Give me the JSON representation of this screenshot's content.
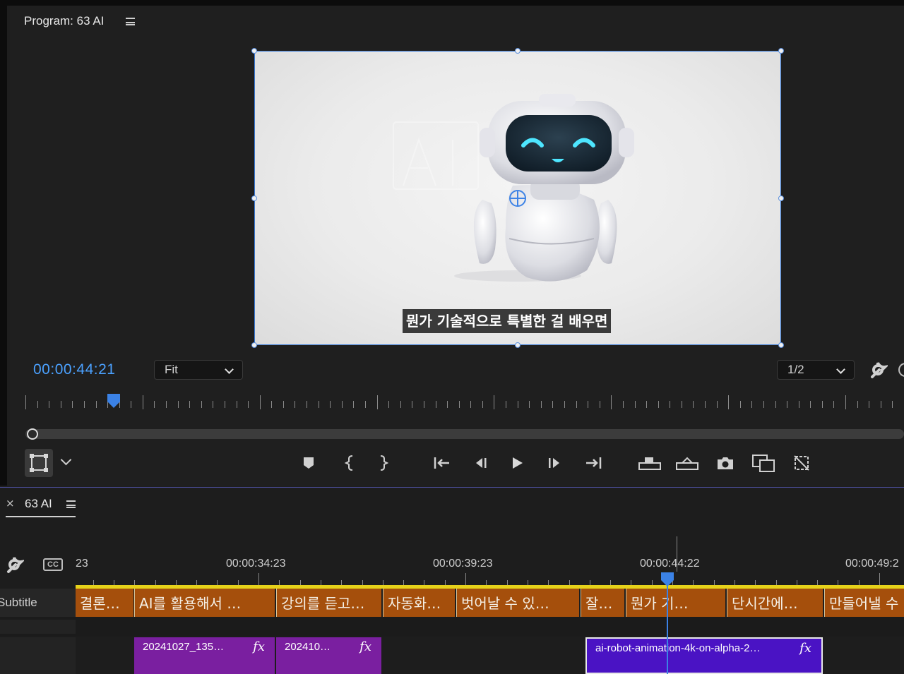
{
  "program_monitor": {
    "title": "Program: 63 AI",
    "subtitle_overlay": "뭔가 기술적으로 특별한 걸 배우면",
    "timecode": "00:00:44:21",
    "zoom_select": "Fit",
    "resolution_select": "1/2"
  },
  "timeline": {
    "tab_close": "×",
    "tab_label": "63 AI",
    "ruler_labels": [
      "23",
      "00:00:34:23",
      "00:00:39:23",
      "00:00:44:22",
      "00:00:49:2"
    ],
    "subtitle_track_label": "Subtitle",
    "subtitle_clips": [
      "결론…",
      "AI를 활용해서 …",
      "강의를 듣고…",
      "자동화…",
      "벗어날 수 있…",
      "잘…",
      "뭔가 기…",
      "단시간에…",
      "만들어낼 수"
    ],
    "video_clips": [
      {
        "label": "20241027_135…",
        "fx": "fx"
      },
      {
        "label": "202410…",
        "fx": "fx"
      },
      {
        "label": "ai-robot-animation-4k-on-alpha-2…",
        "fx": "fx"
      }
    ]
  },
  "colors": {
    "accent_blue": "#4ba1ff",
    "subtitle_clip": "#a54f0c",
    "video_clip_purple": "#7a1fa0",
    "video_clip_selected": "#4a13c4"
  },
  "icons": [
    "menu-icon",
    "wrench-icon",
    "marker-icon",
    "mark-in-icon",
    "mark-out-icon",
    "go-to-in-icon",
    "step-back-icon",
    "play-icon",
    "step-forward-icon",
    "go-to-out-icon",
    "lift-icon",
    "extract-icon",
    "camera-icon",
    "compare-icon",
    "proxy-icon",
    "close-icon",
    "captions-icon",
    "transform-icon",
    "chevron-down-icon"
  ]
}
